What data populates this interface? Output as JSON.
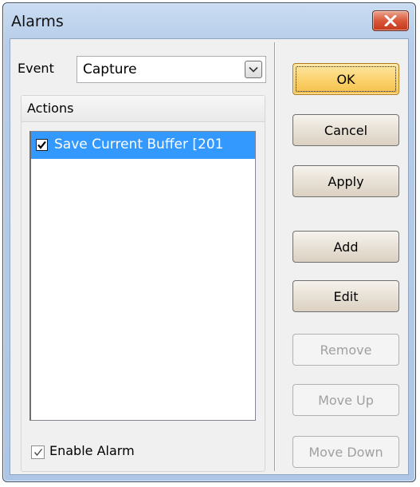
{
  "window": {
    "title": "Alarms"
  },
  "event": {
    "label": "Event",
    "value": "Capture"
  },
  "actions": {
    "header": "Actions",
    "items": [
      {
        "label": "Save Current Buffer [201",
        "checked": true,
        "selected": true
      }
    ]
  },
  "enable_alarm": {
    "label": "Enable Alarm",
    "checked": true
  },
  "buttons": {
    "ok": "OK",
    "cancel": "Cancel",
    "apply": "Apply",
    "add": "Add",
    "edit": "Edit",
    "remove": "Remove",
    "move_up": "Move Up",
    "move_down": "Move Down"
  },
  "colors": {
    "selection": "#3399ff",
    "ok_button": "#fbd36e",
    "close_button": "#d9573a"
  }
}
